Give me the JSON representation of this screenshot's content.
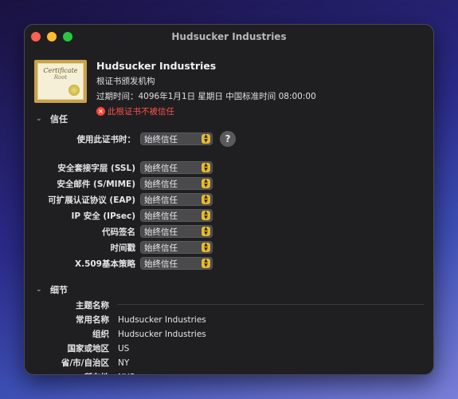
{
  "window": {
    "title": "Hudsucker Industries"
  },
  "certificate": {
    "image_word1": "Certificate",
    "image_word2": "Root",
    "name": "Hudsucker Industries",
    "issuer_type": "根证书颁发机构",
    "expiry": "过期时间：4096年1月1日 星期日 中国标准时间 08:00:00",
    "warning": "此根证书不被信任"
  },
  "trust": {
    "section_label": "信任",
    "use_label": "使用此证书时：",
    "use_value": "始终信任",
    "help_label": "?",
    "policies": [
      {
        "label": "安全套接字层 (SSL)",
        "value": "始终信任"
      },
      {
        "label": "安全邮件 (S/MIME)",
        "value": "始终信任"
      },
      {
        "label": "可扩展认证协议 (EAP)",
        "value": "始终信任"
      },
      {
        "label": "IP 安全 (IPsec)",
        "value": "始终信任"
      },
      {
        "label": "代码签名",
        "value": "始终信任"
      },
      {
        "label": "时间戳",
        "value": "始终信任"
      },
      {
        "label": "X.509基本策略",
        "value": "始终信任"
      }
    ]
  },
  "details": {
    "section_label": "细节",
    "subject_label": "主题名称",
    "rows": [
      {
        "key": "常用名称",
        "value": "Hudsucker Industries"
      },
      {
        "key": "组织",
        "value": "Hudsucker Industries"
      },
      {
        "key": "国家或地区",
        "value": "US"
      },
      {
        "key": "省/市/自治区",
        "value": "NY"
      },
      {
        "key": "所在地",
        "value": "NYC"
      }
    ]
  },
  "colors": {
    "warning": "#ff5148",
    "stepper": "#e4b93a",
    "close": "#fe5f57",
    "minimize": "#febc2e",
    "zoom": "#28c840"
  }
}
